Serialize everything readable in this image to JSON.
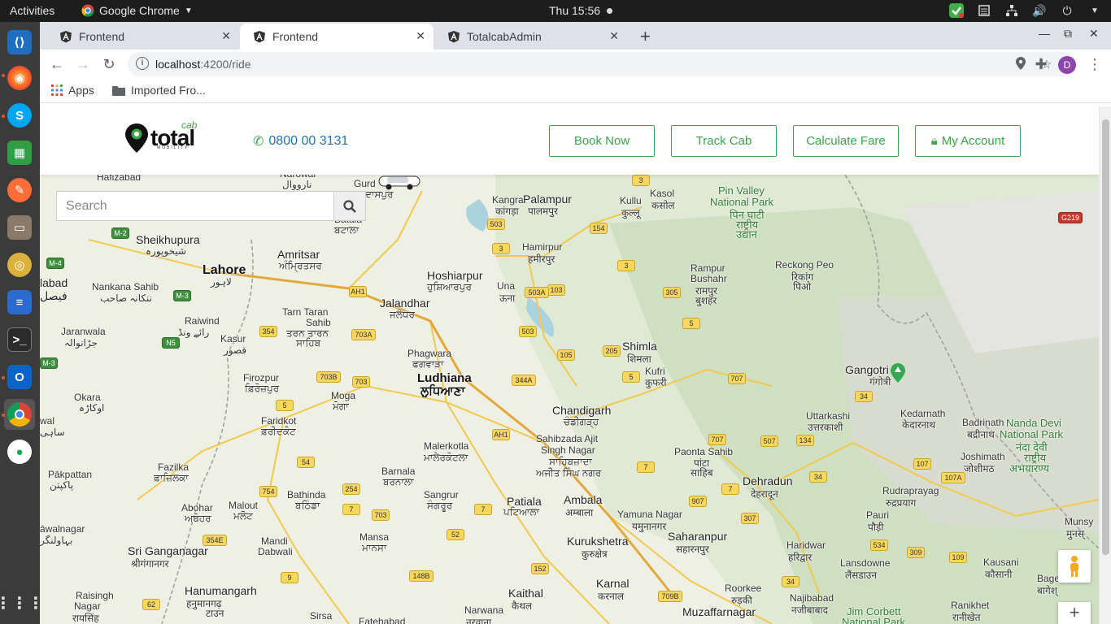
{
  "system": {
    "activities": "Activities",
    "app_name": "Google Chrome",
    "clock": "Thu 15:56"
  },
  "browser": {
    "tabs": [
      {
        "title": "Frontend",
        "active": false
      },
      {
        "title": "Frontend",
        "active": true
      },
      {
        "title": "TotalcabAdmin",
        "active": false
      }
    ],
    "url_host": "localhost",
    "url_rest": ":4200/ride",
    "profile_initial": "D",
    "bookmarks": [
      {
        "label": "Apps"
      },
      {
        "label": "Imported Fro..."
      }
    ]
  },
  "header": {
    "logo_word": "total",
    "logo_cab": "cab",
    "logo_tag": "MOBILITY",
    "phone": "0800 00 3131",
    "buttons": {
      "book_now": "Book Now",
      "track_cab": "Track Cab",
      "calculate_fare": "Calculate Fare",
      "my_account": "My Account"
    }
  },
  "map": {
    "search_placeholder": "Search",
    "labels": {
      "hafizabad": "Hafizabad",
      "narowal": "Narowal",
      "narowal_ur": "نارووال",
      "gurdaspur": "Gurd",
      "gurdaspur_pa": "ਦਾਸਪੁਰ",
      "kangra": "Kangra",
      "kangra_hi": "कांगड़ा",
      "palampur": "Palampur",
      "palampur_hi": "पालमपुर",
      "kullu": "Kullu",
      "kullu_hi": "कुल्लू",
      "kasol": "Kasol",
      "kasol_hi": "कसोल",
      "pin_valley": "Pin Valley",
      "pin_valley2": "National Park",
      "pin_valley_hi": "पिन घाटी",
      "pin_valley_hi2": "राष्ट्रीय",
      "pin_valley_hi3": "उद्यान",
      "sheikhupura": "Sheikhupura",
      "sheikhupura_ur": "شیخوپورہ",
      "amritsar": "Amritsar",
      "amritsar_pa": "ਅੰਮ੍ਰਿਤਸਰ",
      "batala": "Batala",
      "batala_pa": "ਬਟਾਲਾ",
      "hamirpur": "Hamirpur",
      "hamirpur_hi": "हमीरपुर",
      "lahore": "Lahore",
      "lahore_ur": "لاہور",
      "faisalabad": "labad",
      "faisalabad_ur": "فیصل",
      "nankana": "Nankana Sahib",
      "nankana_ur": "ننکانہ صاحب",
      "hoshiarpur": "Hoshiarpur",
      "hoshiarpur_pa": "ਹੁਸ਼ਿਆਰਪੁਰ",
      "una": "Una",
      "una_hi": "ऊना",
      "rampur": "Rampur",
      "rampur2": "Bushahr",
      "rampur_hi": "रामपुर",
      "rampur_hi2": "बुशहर",
      "reckong": "Reckong Peo",
      "reckong_hi": "रिकांग",
      "reckong_hi2": "पिओ",
      "tarn_taran": "Tarn Taran",
      "tarn_taran2": "Sahib",
      "tarn_taran_pa": "ਤਰਨ ਤਾਰਨ",
      "tarn_taran_pa2": "ਸਾਹਿਬ",
      "raiwind": "Raiwind",
      "raiwind_ur": "رائے ونڈ",
      "jaranwala": "Jaranwala",
      "jaranwala_ur": "جڑانوالہ",
      "jalandhar": "Jalandhar",
      "jalandhar_pa": "ਜਲੰਧਰ",
      "kasur": "Kasur",
      "kasur_ur": "قصور",
      "phagwara": "Phagwara",
      "phagwara_pa": "ਫਗਵਾੜਾ",
      "shimla": "Shimla",
      "shimla_hi": "शिमला",
      "kufri": "Kufri",
      "kufri_hi": "कुफरी",
      "gangotri": "Gangotri",
      "gangotri_hi": "गंगोत्री",
      "ludhiana": "Ludhiana",
      "ludhiana_pa": "ਲੁਧਿਆਣਾ",
      "firozpur": "Firozpur",
      "firozpur_pa": "ਫ਼ਿਰੋਜ਼ਪੁਰ",
      "moga": "Moga",
      "moga_pa": "ਮੋਗਾ",
      "okara": "Okara",
      "okara_ur": "اوکاڑہ",
      "sahiwal": "wal",
      "sahiwal_ur": "ساہی",
      "chandigarh": "Chandigarh",
      "chandigarh_pa": "ਚੰਡੀਗੜ੍ਹ",
      "faridkot": "Faridkot",
      "faridkot_pa": "ਫ਼ਰੀਦਕੋਟ",
      "kedarnath": "Kedarnath",
      "kedarnath_hi": "केदारनाथ",
      "badrinath": "Badrinath",
      "badrinath_hi": "बद्रीनाथ",
      "uttarkashi": "Uttarkashi",
      "uttarkashi_hi": "उत्तरकाशी",
      "nanda_devi": "Nanda Devi",
      "nanda_devi2": "National Park",
      "nanda_devi_hi": "नंदा देवी",
      "nanda_devi_hi2": "राष्ट्रीय",
      "nanda_devi_hi3": "अभयारण्य",
      "malerkotla": "Malerkotla",
      "malerkotla_pa": "ਮਾਲੇਰਕੋਟਲਾ",
      "mohali": "Sahibzada Ajit",
      "mohali2": "Singh Nagar",
      "mohali_pa": "ਸਾਹਿਬਜ਼ਾਦਾ",
      "mohali_pa2": "ਅਜੀਤ ਸਿੰਘ ਨਗਰ",
      "paonta": "Paonta Sahib",
      "paonta_hi": "पांटा",
      "paonta_hi2": "साहिब",
      "joshimath": "Joshimath",
      "joshimath_hi": "जोशीमठ",
      "pakpattan": "Pākpattan",
      "pakpattan_ur": "پاکپتن",
      "fazilka": "Fazilka",
      "fazilka_pa": "ਫ਼ਾਜ਼ਿਲਕਾ",
      "barnala": "Barnala",
      "barnala_pa": "ਬਰਨਾਲਾ",
      "dehradun": "Dehradun",
      "dehradun_hi": "देहरादून",
      "rudraprayag": "Rudraprayag",
      "rudraprayag_hi": "रुद्रप्रयाग",
      "bathinda": "Bathinda",
      "bathinda_pa": "ਬਠਿੰਡਾ",
      "sangrur": "Sangrur",
      "sangrur_pa": "ਸੰਗਰੂਰ",
      "patiala": "Patiala",
      "patiala_pa": "ਪਟਿਆਲਾ",
      "ambala": "Ambala",
      "ambala_hi": "अम्बाला",
      "abohar": "Abohar",
      "abohar_pa": "ਅਬੋਹਰ",
      "malout": "Malout",
      "malout_pa": "ਮਲੋਟ",
      "yamuna": "Yamuna Nagar",
      "yamuna_hi": "यमुनानगर",
      "pauri": "Pauri",
      "pauri_hi": "पौड़ी",
      "munsyari": "Munsy",
      "munsyari_hi": "मुनस्",
      "bahawalnagar": "āwalnagar",
      "bahawalnagar_ur": "بہاولنگر",
      "mansa": "Mansa",
      "mansa_pa": "ਮਾਨਸਾ",
      "kurukshetra": "Kurukshetra",
      "kurukshetra_hi": "कुरुक्षेत्र",
      "saharanpur": "Saharanpur",
      "saharanpur_hi": "सहारनपुर",
      "haridwar": "Haridwar",
      "haridwar_hi": "हरिद्वार",
      "sri_ganganagar": "Sri Ganganagar",
      "sri_ganganagar_hi": "श्रीगंगानगर",
      "mandi_dabwali": "Mandi",
      "mandi_dabwali2": "Dabwali",
      "lansdowne": "Lansdowne",
      "lansdowne_hi": "लैंसडाउन",
      "kausani": "Kausani",
      "kausani_hi": "कौसानी",
      "bageshwar": "Bagesh",
      "bageshwar_hi": "बागेश्",
      "hanumangarh": "Hanumangarh",
      "hanumangarh_hi": "हनुमानगढ़",
      "hanumangarh_hi2": "टाउन",
      "raisingh": "Raisingh",
      "raisingh2": "Nagar",
      "raisingh_hi": "रायसिंह",
      "karnal": "Karnal",
      "karnal_hi": "करनाल",
      "kaithal": "Kaithal",
      "kaithal_hi": "कैथल",
      "roorkee": "Roorkee",
      "roorkee_hi": "रुड़की",
      "najibabad": "Najibabad",
      "najibabad_hi": "नजीबाबाद",
      "jim_corbett": "Jim Corbett",
      "jim_corbett2": "National Park",
      "ranikhet": "Ranikhet",
      "ranikhet_hi": "रानीखेत",
      "sirsa": "Sirsa",
      "fatehabad": "Fatehabad",
      "narwana": "Narwana",
      "narwana_hi": "नरवाना",
      "muzaffarnagar": "Muzaffarnagar"
    },
    "shields": [
      "M-2",
      "M-4",
      "M-3",
      "M-3",
      "N5",
      "3",
      "503",
      "154",
      "3",
      "3",
      "503A",
      "103",
      "305",
      "5",
      "5",
      "503A",
      "AH1",
      "503",
      "105",
      "205",
      "5",
      "703A",
      "354",
      "703B",
      "703",
      "344A",
      "707",
      "34",
      "5",
      "AH1",
      "707",
      "507",
      "134",
      "54",
      "7",
      "107",
      "107A",
      "254",
      "754",
      "7",
      "907",
      "7",
      "34",
      "703",
      "52",
      "7",
      "307",
      "354E",
      "9",
      "148B",
      "152",
      "709B",
      "62",
      "534",
      "309",
      "109",
      "34",
      "G219"
    ]
  }
}
